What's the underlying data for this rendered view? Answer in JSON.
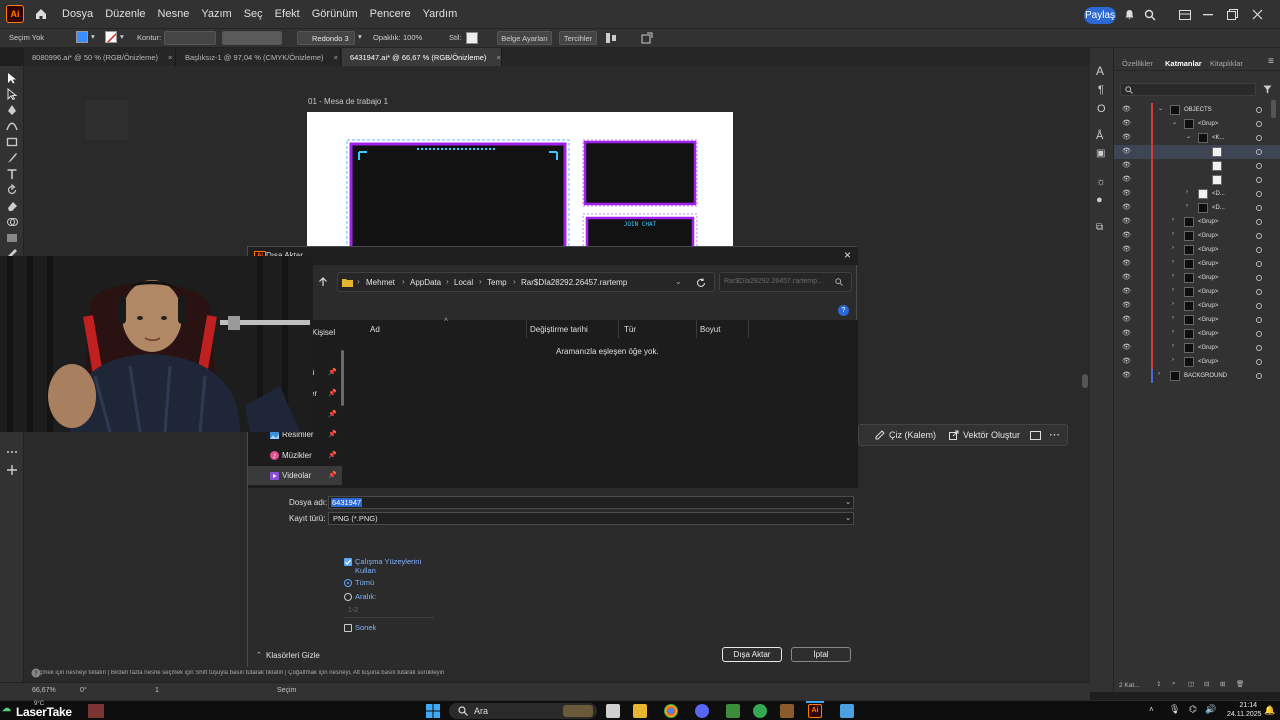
{
  "menubar": {
    "app_badge": "Ai",
    "items": [
      "Dosya",
      "Düzenle",
      "Nesne",
      "Yazım",
      "Seç",
      "Efekt",
      "Görünüm",
      "Pencere",
      "Yardım"
    ],
    "share_label": "Paylaş"
  },
  "controlbar": {
    "selection": "Seçim Yok",
    "stroke_label": "Kontur:",
    "brush": "Redondo 3 ...",
    "opacity_label": "Opaklık:",
    "opacity_value": "100%",
    "style_label": "Stil:",
    "doc_setup": "Belge Ayarları",
    "preferences": "Tercihler"
  },
  "tabs": [
    {
      "label": "8080996.ai* @ 50 % (RGB/Önizleme)",
      "close": "×"
    },
    {
      "label": "Başlıksız-1 @ 97,04 % (CMYK/Önizleme)",
      "close": "×"
    },
    {
      "label": "6431947.ai* @ 66,67 % (RGB/Önizleme)",
      "close": "×"
    }
  ],
  "canvas": {
    "artboard_label": "01 - Mesa de trabajo 1",
    "art_text": "JOIN CHAT"
  },
  "context_bar": {
    "pen_label": "Çiz (Kalem)",
    "vector_label": "Vektör Oluştur"
  },
  "panel": {
    "tabs": [
      "Özellikler",
      "Katmanlar",
      "Kitaplıklar"
    ],
    "search_placeholder": "",
    "layers": [
      {
        "name": "OBJECTS",
        "indent": 0
      },
      {
        "name": "<Grup>",
        "indent": 1
      },
      {
        "name": "<K...",
        "indent": 2
      },
      {
        "name": "",
        "indent": 3
      },
      {
        "name": "",
        "indent": 3
      },
      {
        "name": "",
        "indent": 3
      },
      {
        "name": "<D...",
        "indent": 2
      },
      {
        "name": "<D...",
        "indent": 2
      },
      {
        "name": "<Grup>",
        "indent": 1
      },
      {
        "name": "<Grup>",
        "indent": 1
      },
      {
        "name": "<Grup>",
        "indent": 1
      },
      {
        "name": "<Grup>",
        "indent": 1
      },
      {
        "name": "<Grup>",
        "indent": 1
      },
      {
        "name": "<Grup>",
        "indent": 1
      },
      {
        "name": "<Grup>",
        "indent": 1
      },
      {
        "name": "<Grup>",
        "indent": 1
      },
      {
        "name": "<Grup>",
        "indent": 1
      },
      {
        "name": "<Grup>",
        "indent": 1
      },
      {
        "name": "<Grup>",
        "indent": 1
      },
      {
        "name": "BACKGROUND",
        "indent": 0
      }
    ],
    "footer_label": "2 Kat..."
  },
  "statusbar": {
    "hint": "Seçmek için nesneyi tıklatın  |  Birden fazla nesne seçmek için Shift tuşuyla basılı tutarak tıklatın  |  Çoğaltmak için nesneyi, Alt tuşuna basılı tutarak sürükleyin",
    "zoom": "66,67%",
    "rotation": "0°",
    "page": "1",
    "mode": "Seçim"
  },
  "dialog": {
    "title": "Dışa Aktar",
    "close": "×",
    "breadcrumb": [
      "Mehmet",
      "AppData",
      "Local",
      "Temp",
      "Rar$DIa28292.26457.rartemp"
    ],
    "search_placeholder": "Rar$DIa28292.26457.rartemp...",
    "help": "?",
    "columns": [
      "Ad",
      "Değiştirme tarihi",
      "Tür",
      "Boyut"
    ],
    "empty_message": "Aramanızla eşleşen öğe yok.",
    "nav_items": [
      {
        "label": "Kişisel"
      },
      {
        "label": "ü"
      },
      {
        "label": "er"
      },
      {
        "label": ""
      },
      {
        "label": "Resimler"
      },
      {
        "label": "Müzikler"
      },
      {
        "label": "Videolar"
      }
    ],
    "filename_label": "Dosya adı:",
    "filename_value": "6431947",
    "filetype_label": "Kayıt türü:",
    "filetype_value": "PNG (*.PNG)",
    "use_artboards": "Çalışma Yüzeylerini Kullan",
    "all_label": "Tümü",
    "range_label": "Aralık:",
    "range_value": "1-2",
    "after_label": "Sonek",
    "hide_folders": "Klasörleri Gizle",
    "export_btn": "Dışa Aktar",
    "cancel_btn": "İptal"
  },
  "taskbar": {
    "weather": "9°C",
    "app_label": "LaserTake",
    "search_label": "Ara",
    "time": "21:14",
    "date": "24.11.2025"
  },
  "colors": {
    "accent_blue": "#2c69d4",
    "ai_orange": "#ff7c00",
    "neon_purple": "#a020f0",
    "neon_cyan": "#36c8ff",
    "layer_red": "#d83a3a"
  }
}
